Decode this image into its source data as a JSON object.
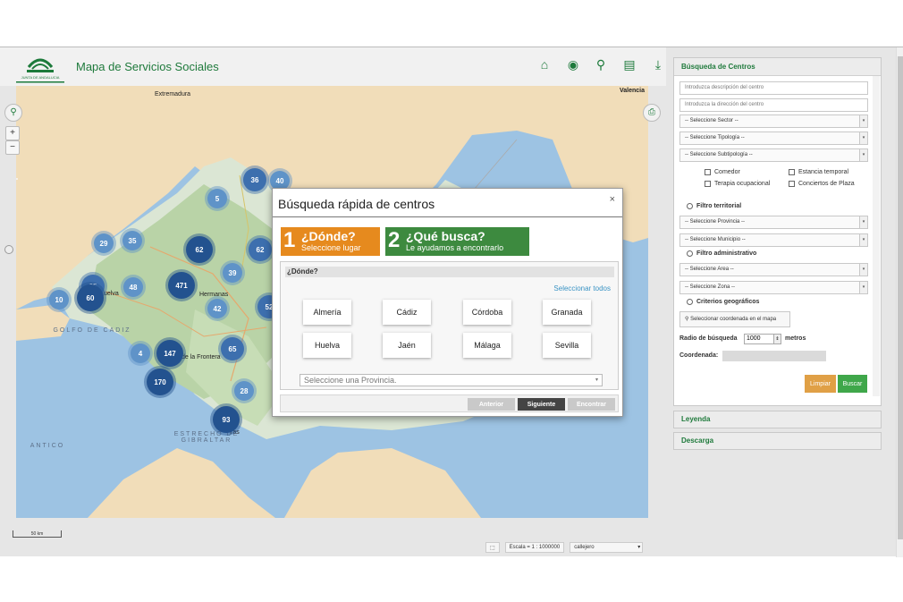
{
  "app": {
    "title": "Mapa de Servicios Sociales",
    "logo_text": "JUNTA DE ANDALUCIA"
  },
  "toolbar": {
    "icons": [
      "home-icon",
      "locate-icon",
      "search-icon",
      "report-icon",
      "download-icon"
    ],
    "accent": "#1d7a3b"
  },
  "map": {
    "labels": {
      "extremadura": "Extremadura",
      "valencia": "Valencia",
      "huelva": "uelva",
      "hermanas": "Hermanas",
      "frontera": "de la Frontera",
      "ras": "ras"
    },
    "sea_labels": {
      "golfo": "GOLFO DE CADIZ",
      "estrecho": "ESTRECHO DE GIBRALTAR",
      "atlantico": "ANTICO"
    },
    "clusters": [
      "36",
      "40",
      "5",
      "29",
      "35",
      "62",
      "62",
      "39",
      "65",
      "60",
      "48",
      "471",
      "10",
      "42",
      "52",
      "4",
      "147",
      "65",
      "170",
      "28",
      "93"
    ],
    "zoom_in": "+",
    "zoom_out": "−",
    "scale": "50 km",
    "status": {
      "scale_text": "Escala = 1 : 1000000",
      "layer": "callejero"
    }
  },
  "modal": {
    "title": "Búsqueda rápida de centros",
    "close": "×",
    "steps": [
      {
        "num": "1",
        "title": "¿Dónde?",
        "subtitle": "Seleccione lugar",
        "color": "#e68a1e"
      },
      {
        "num": "2",
        "title": "¿Qué busca?",
        "subtitle": "Le ayudamos a encontrarlo",
        "color": "#3d8a3f"
      }
    ],
    "where": {
      "header": "¿Dónde?",
      "select_all": "Seleccionar todos",
      "provinces": [
        "Almería",
        "Cádiz",
        "Córdoba",
        "Granada",
        "Huelva",
        "Jaén",
        "Málaga",
        "Sevilla"
      ],
      "select_placeholder": "Seleccione una Provincia."
    },
    "buttons": {
      "prev": "Anterior",
      "next": "Siguiente",
      "find": "Encontrar"
    }
  },
  "panel": {
    "title": "Búsqueda de Centros",
    "desc_placeholder": "Introduzca descripción del centro",
    "addr_placeholder": "Introduzca la dirección del centro",
    "sector": "-- Seleccione Sector --",
    "tipologia": "-- Seleccione Tipología --",
    "subtipologia": "-- Seleccione Subtipología --",
    "checks": [
      "Comedor",
      "Estancia temporal",
      "Terapia ocupacional",
      "Conciertos de Plaza"
    ],
    "filtro_territorial": "Filtro territorial",
    "provincia": "-- Seleccione Provincia --",
    "municipio": "-- Seleccione Municipio --",
    "filtro_admin": "Filtro administrativo",
    "area": "-- Seleccione Area --",
    "zona": "-- Seleccione Zona --",
    "criterios": "Criterios geográficos",
    "coord_btn": "Seleccionar coordenada en el mapa",
    "radio_label": "Radio de búsqueda",
    "radio_value": "1000",
    "radio_unit": "metros",
    "coord_label": "Coordenada:",
    "clear": "Limpiar",
    "search": "Buscar"
  },
  "accordions": {
    "legend": "Leyenda",
    "download": "Descarga"
  }
}
